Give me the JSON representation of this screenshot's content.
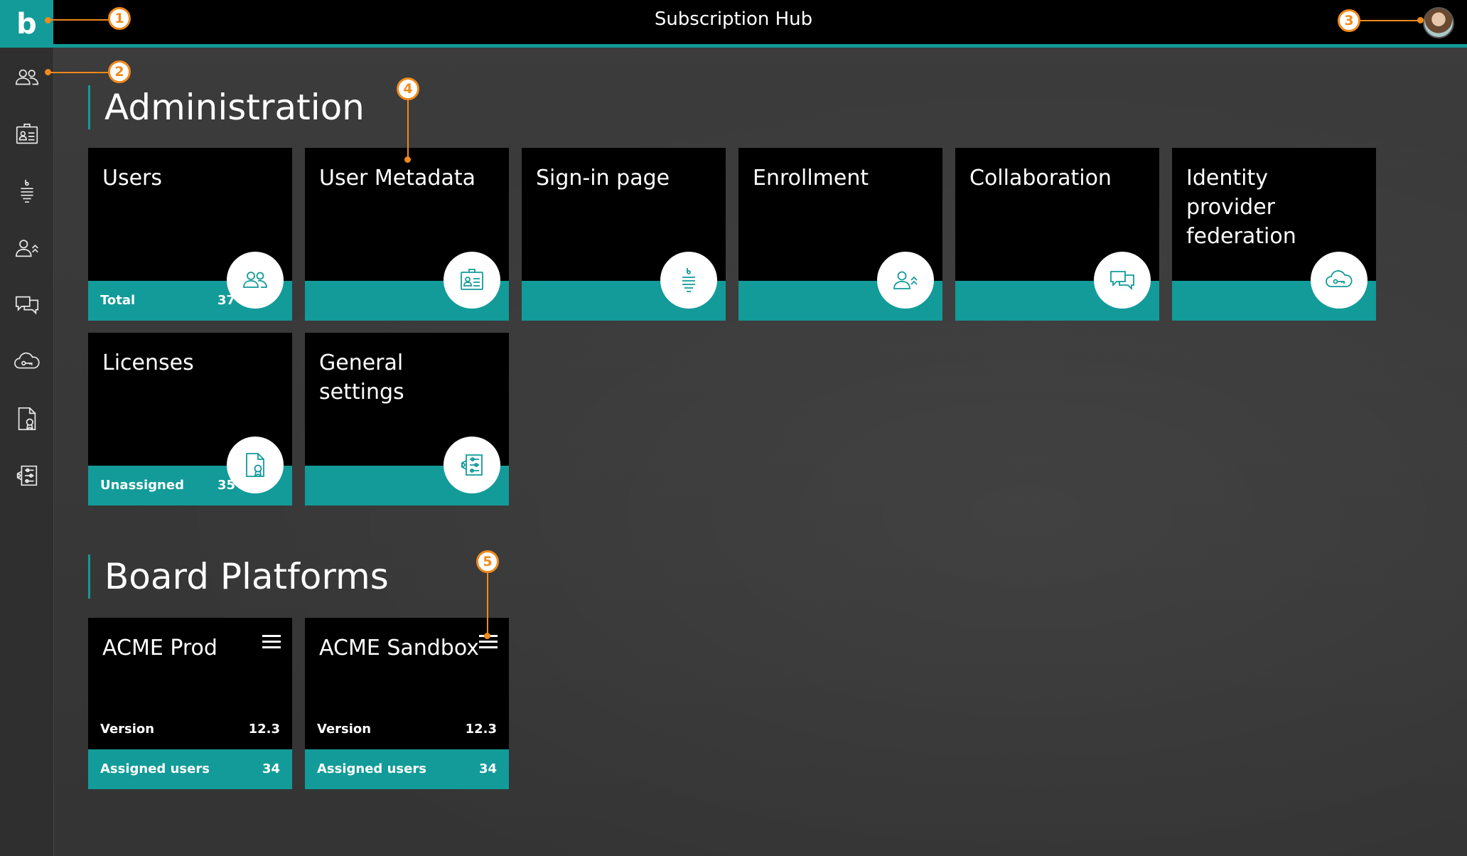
{
  "header": {
    "logo": "b",
    "title": "Subscription Hub"
  },
  "sidebar": {
    "items": [
      {
        "icon": "users-icon"
      },
      {
        "icon": "id-card-icon"
      },
      {
        "icon": "sign-in-icon"
      },
      {
        "icon": "enrollment-icon"
      },
      {
        "icon": "chat-icon"
      },
      {
        "icon": "cloud-key-icon"
      },
      {
        "icon": "license-icon"
      },
      {
        "icon": "settings-icon"
      }
    ]
  },
  "callouts": [
    "1",
    "2",
    "3",
    "4",
    "5"
  ],
  "administration": {
    "title": "Administration",
    "tiles": [
      {
        "title": "Users",
        "footer_label": "Total",
        "footer_value": "37",
        "icon": "users-icon"
      },
      {
        "title": "User Metadata",
        "icon": "id-card-icon"
      },
      {
        "title": "Sign-in page",
        "icon": "sign-in-icon"
      },
      {
        "title": "Enrollment",
        "icon": "enrollment-icon"
      },
      {
        "title": "Collaboration",
        "icon": "chat-icon"
      },
      {
        "title": "Identity provider federation",
        "icon": "cloud-key-icon"
      },
      {
        "title": "Licenses",
        "footer_label": "Unassigned",
        "footer_value": "35",
        "icon": "license-icon"
      },
      {
        "title": "General settings",
        "icon": "settings-icon"
      }
    ]
  },
  "platforms": {
    "title": "Board Platforms",
    "tiles": [
      {
        "title": "ACME Prod",
        "version_label": "Version",
        "version": "12.3",
        "users_label": "Assigned users",
        "users": "34"
      },
      {
        "title": "ACME Sandbox",
        "version_label": "Version",
        "version": "12.3",
        "users_label": "Assigned users",
        "users": "34"
      }
    ]
  },
  "colors": {
    "accent": "#129b99",
    "callout": "#f08a1c",
    "tile": "#000000"
  }
}
